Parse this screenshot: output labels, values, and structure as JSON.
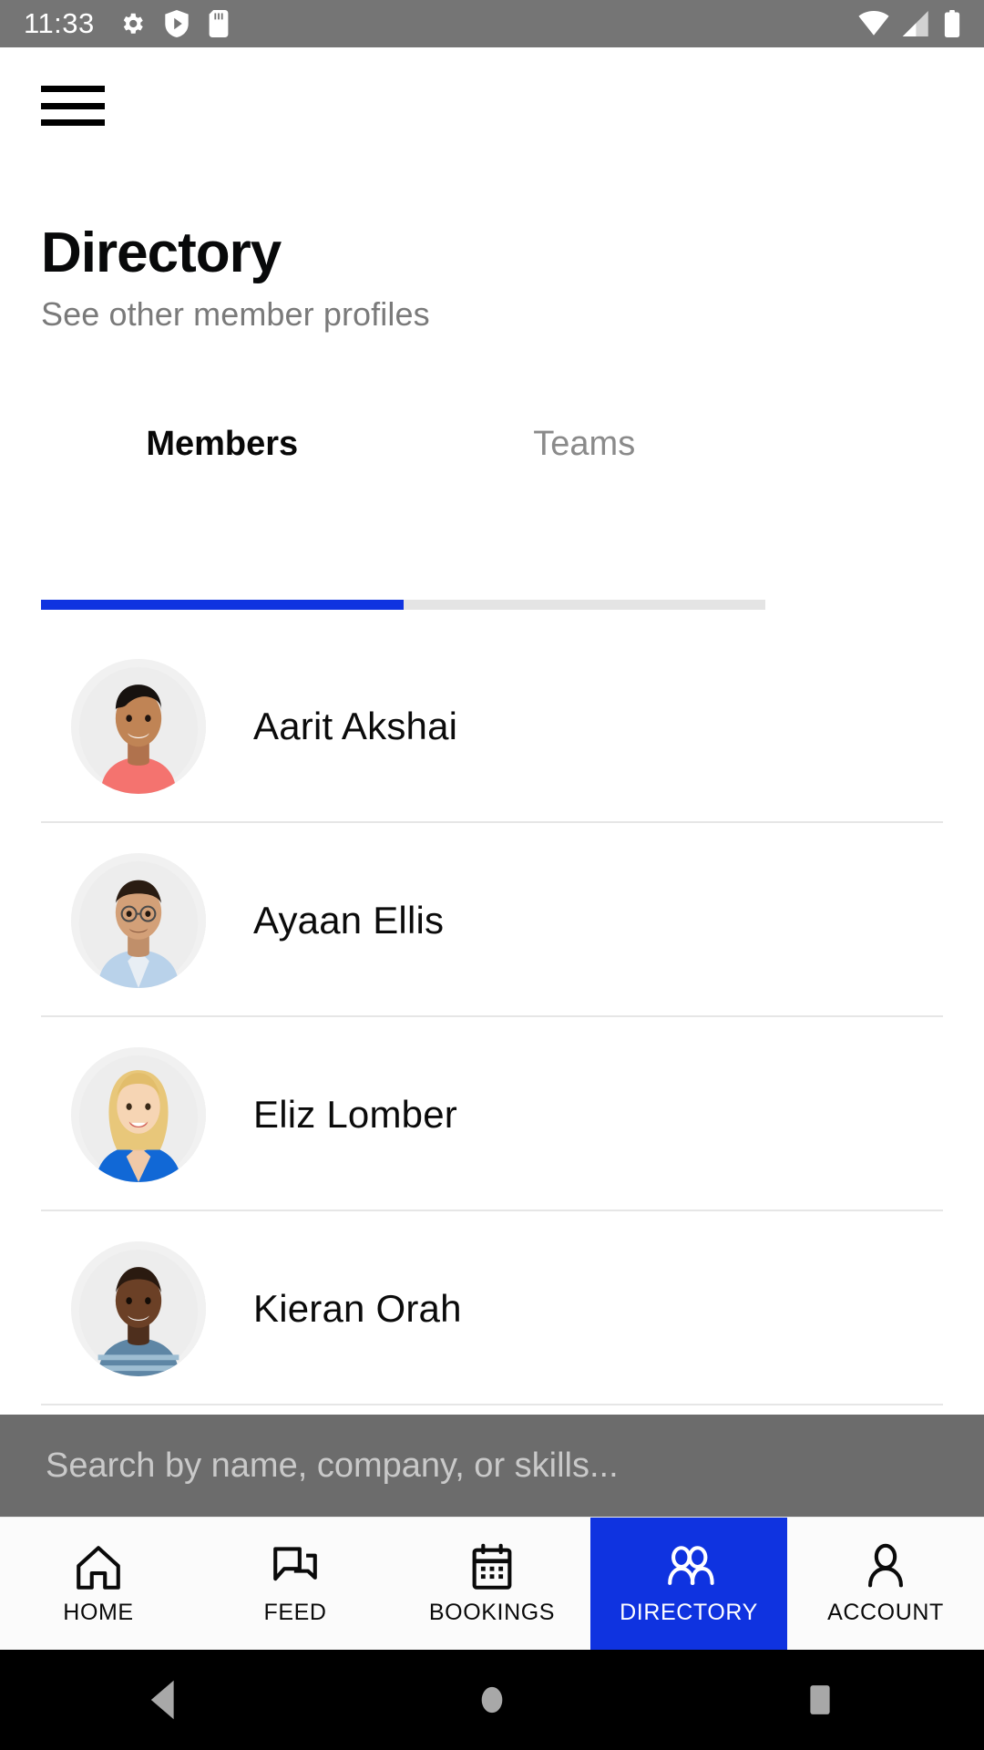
{
  "status_bar": {
    "time": "11:33",
    "left_icons": [
      "gear-icon",
      "shield-play-icon",
      "sd-card-icon"
    ],
    "right_icons": [
      "wifi-icon",
      "cellular-signal-icon",
      "battery-icon"
    ],
    "background": "#757575"
  },
  "app_bar": {
    "menu_icon": "hamburger-menu-icon"
  },
  "header": {
    "title": "Directory",
    "subtitle": "See other member profiles"
  },
  "tabs": {
    "items": [
      {
        "label": "Members",
        "active": true
      },
      {
        "label": "Teams",
        "active": false
      }
    ],
    "indicator_color": "#0f33e0",
    "track_color": "#e4e4e4"
  },
  "members": [
    {
      "name": "Aarit Akshai",
      "avatar": "photo-man-coral-polo"
    },
    {
      "name": "Ayaan Ellis",
      "avatar": "photo-man-glasses-blue-shirt"
    },
    {
      "name": "Eliz Lomber",
      "avatar": "photo-woman-blonde-blue-top"
    },
    {
      "name": "Kieran Orah",
      "avatar": "photo-man-striped-shirt"
    }
  ],
  "search": {
    "placeholder": "Search by name, company, or skills...",
    "value": ""
  },
  "bottom_nav": {
    "items": [
      {
        "label": "HOME",
        "icon": "home-icon",
        "active": false
      },
      {
        "label": "FEED",
        "icon": "chat-bubbles-icon",
        "active": false
      },
      {
        "label": "BOOKINGS",
        "icon": "calendar-icon",
        "active": false
      },
      {
        "label": "DIRECTORY",
        "icon": "people-icon",
        "active": true
      },
      {
        "label": "ACCOUNT",
        "icon": "person-icon",
        "active": false
      }
    ],
    "active_color": "#0f33e0"
  },
  "android_nav": {
    "back": "back-triangle-icon",
    "home": "home-circle-icon",
    "recents": "recents-square-icon"
  }
}
